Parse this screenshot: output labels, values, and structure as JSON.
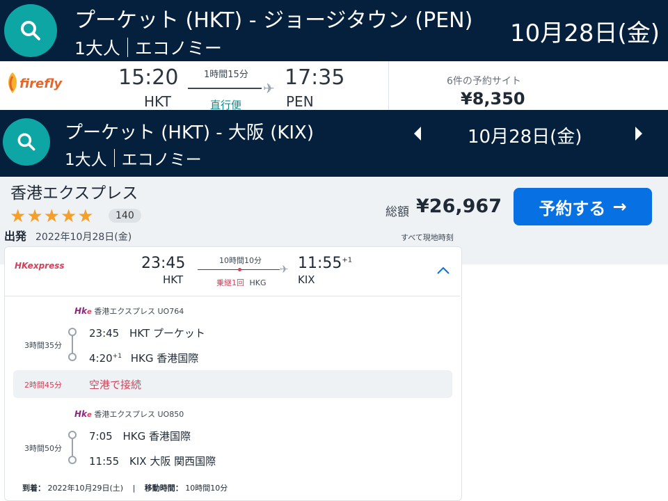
{
  "header1": {
    "route": "プーケット (HKT) - ジョージタウン (PEN)",
    "passengers": "1大人",
    "cabin": "エコノミー",
    "date": "10月28日(金)"
  },
  "firefly": {
    "airline": "firefly",
    "dep_time": "15:20",
    "dep_code": "HKT",
    "duration": "1時間15分",
    "stops": "直行便",
    "arr_time": "17:35",
    "arr_code": "PEN",
    "sites": "6件の予約サイト",
    "price": "¥8,350"
  },
  "header2": {
    "route": "プーケット (HKT) - 大阪 (KIX)",
    "passengers": "1大人",
    "cabin": "エコノミー",
    "date": "10月28日(金)"
  },
  "card": {
    "provider": "香港エクスプレス",
    "review_count": "140",
    "rating": 5,
    "total_label": "総額",
    "total_price": "¥26,967",
    "book_label": "予約する",
    "book_arrow": "→",
    "depart_label": "出発",
    "depart_date": "2022年10月28日(金)",
    "local_time_note": "すべて現地時刻",
    "summary": {
      "logo": "HKexpress",
      "dep_time": "23:45",
      "dep_code": "HKT",
      "duration": "10時間10分",
      "stops": "乗継1回",
      "via": "HKG",
      "arr_time": "11:55",
      "arr_plus": "+1",
      "arr_code": "KIX"
    },
    "segments": [
      {
        "airline": "香港エクスプレス UO764",
        "duration": "3時間35分",
        "dep_time": "23:45",
        "dep_place": "HKT プーケット",
        "arr_time": "4:20",
        "arr_plus": "+1",
        "arr_place": "HKG 香港国際"
      },
      {
        "airline": "香港エクスプレス UO850",
        "duration": "3時間50分",
        "dep_time": "7:05",
        "dep_place": "HKG 香港国際",
        "arr_time": "11:55",
        "arr_place": "KIX 大阪 関西国際"
      }
    ],
    "connection": {
      "duration": "2時間45分",
      "label": "空港で接続"
    },
    "footer": {
      "arrive_label": "到着：",
      "arrive_date": "2022年10月29日(土)",
      "sep": "|",
      "travel_label": "移動時間：",
      "travel_time": "10時間10分"
    }
  },
  "colors": {
    "header_bg": "#05203c",
    "search_teal": "#0ea5a5",
    "book_blue": "#0770e3",
    "stop_red": "#d1435b",
    "star_orange": "#f59f2a"
  }
}
